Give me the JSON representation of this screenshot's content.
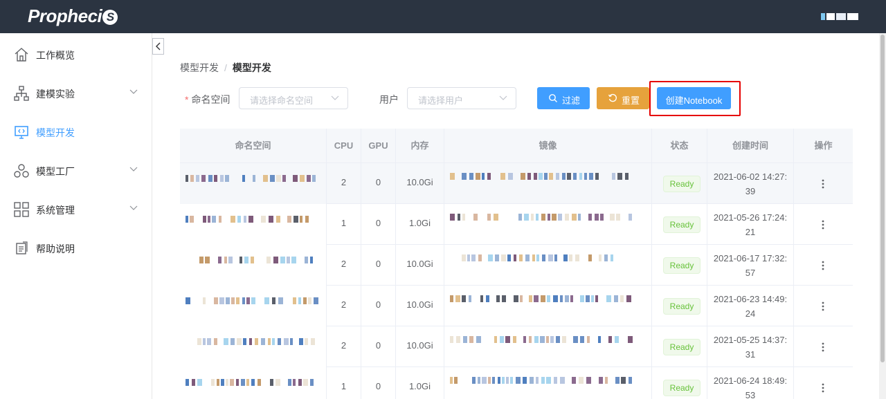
{
  "app": {
    "logo_text": "Propheci",
    "logo_badge": "S"
  },
  "sidebar": {
    "items": [
      {
        "label": "工作概览",
        "icon": "home-icon",
        "expandable": false,
        "active": false
      },
      {
        "label": "建模实验",
        "icon": "hierarchy-icon",
        "expandable": true,
        "active": false
      },
      {
        "label": "模型开发",
        "icon": "monitor-code-icon",
        "expandable": false,
        "active": true
      },
      {
        "label": "模型工厂",
        "icon": "cluster-icon",
        "expandable": true,
        "active": false
      },
      {
        "label": "系统管理",
        "icon": "grid-icon",
        "expandable": true,
        "active": false
      },
      {
        "label": "帮助说明",
        "icon": "document-icon",
        "expandable": false,
        "active": false
      }
    ]
  },
  "breadcrumb": {
    "parent": "模型开发",
    "separator": "/",
    "current": "模型开发"
  },
  "filters": {
    "namespace_label": "命名空间",
    "namespace_required_mark": "*",
    "namespace_placeholder": "请选择命名空间",
    "user_label": "用户",
    "user_placeholder": "请选择用户"
  },
  "buttons": {
    "filter": "过滤",
    "reset": "重置",
    "create": "创建Notebook"
  },
  "colors": {
    "primary": "#409eff",
    "warning": "#e6a23c",
    "success": "#67c23a",
    "highlight": "#e60000",
    "topbar": "#2b3441"
  },
  "table": {
    "columns": [
      "命名空间",
      "CPU",
      "GPU",
      "内存",
      "镜像",
      "状态",
      "创建时间",
      "操作"
    ],
    "rows": [
      {
        "cpu": "2",
        "gpu": "0",
        "memory": "10.0Gi",
        "status": "Ready",
        "date": "2021-06-02 14:27:",
        "time_tail": "39"
      },
      {
        "cpu": "1",
        "gpu": "0",
        "memory": "1.0Gi",
        "status": "Ready",
        "date": "2021-05-26 17:24:",
        "time_tail": "21"
      },
      {
        "cpu": "2",
        "gpu": "0",
        "memory": "10.0Gi",
        "status": "Ready",
        "date": "2021-06-17 17:32:",
        "time_tail": "57"
      },
      {
        "cpu": "2",
        "gpu": "0",
        "memory": "10.0Gi",
        "status": "Ready",
        "date": "2021-06-23 14:49:",
        "time_tail": "24"
      },
      {
        "cpu": "2",
        "gpu": "0",
        "memory": "10.0Gi",
        "status": "Ready",
        "date": "2021-05-25 14:37:",
        "time_tail": "31"
      },
      {
        "cpu": "1",
        "gpu": "0",
        "memory": "1.0Gi",
        "status": "Ready",
        "date": "2021-06-24 18:49:",
        "time_tail": "53"
      }
    ]
  }
}
